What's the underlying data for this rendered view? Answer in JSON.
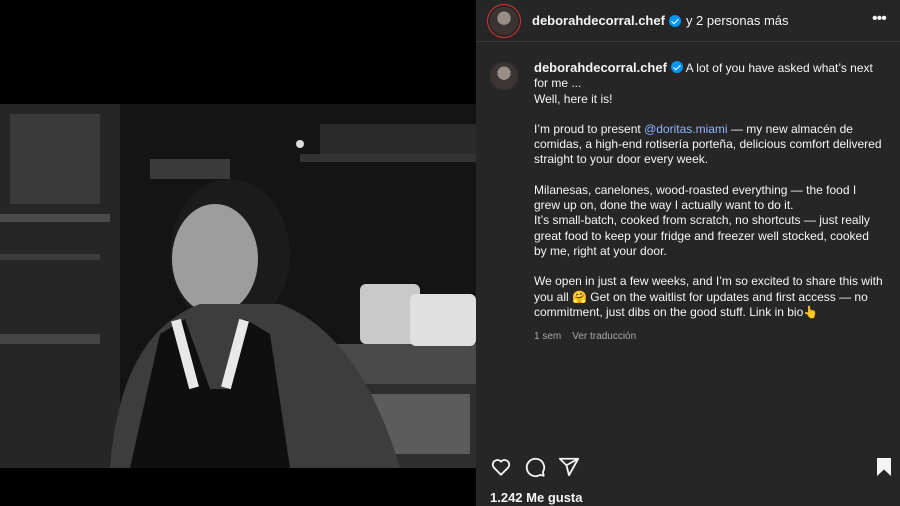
{
  "header": {
    "username": "deborahdecorral.chef",
    "collaborators": "y 2 personas más",
    "more_icon": "more-horizontal-icon"
  },
  "caption": {
    "username": "deborahdecorral.chef",
    "lines": {
      "p1a": "A lot of you have asked what’s next for me ...",
      "p1b": "Well, here it is!",
      "p2_before": "I’m proud to present ",
      "p2_mention": "@doritas.miami",
      "p2_after": " — my new almacén de comidas, a high-end rotisería porteña, delicious comfort delivered straight to your door every week.",
      "p3a": "Milanesas, canelones, wood-roasted everything — the food I grew up on, done the way I actually want to do it.",
      "p3b": "It’s small-batch, cooked from scratch, no shortcuts — just really great food to keep your fridge and freezer well stocked, cooked by me, right at your door.",
      "p4": "We open in just a few weeks, and I’m so excited to share this with you all 🤗 Get on the waitlist for updates and first access — no commitment, just dibs on the good stuff. Link in bio👆"
    },
    "time": "1 sem",
    "translate": "Ver traducción"
  },
  "actions": {
    "like_icon": "heart-icon",
    "comment_icon": "comment-icon",
    "share_icon": "share-icon",
    "save_icon": "bookmark-icon"
  },
  "likes": "1.242 Me gusta",
  "media": {
    "description_icon": "photo-black-and-white",
    "accent": "#0095f6"
  }
}
